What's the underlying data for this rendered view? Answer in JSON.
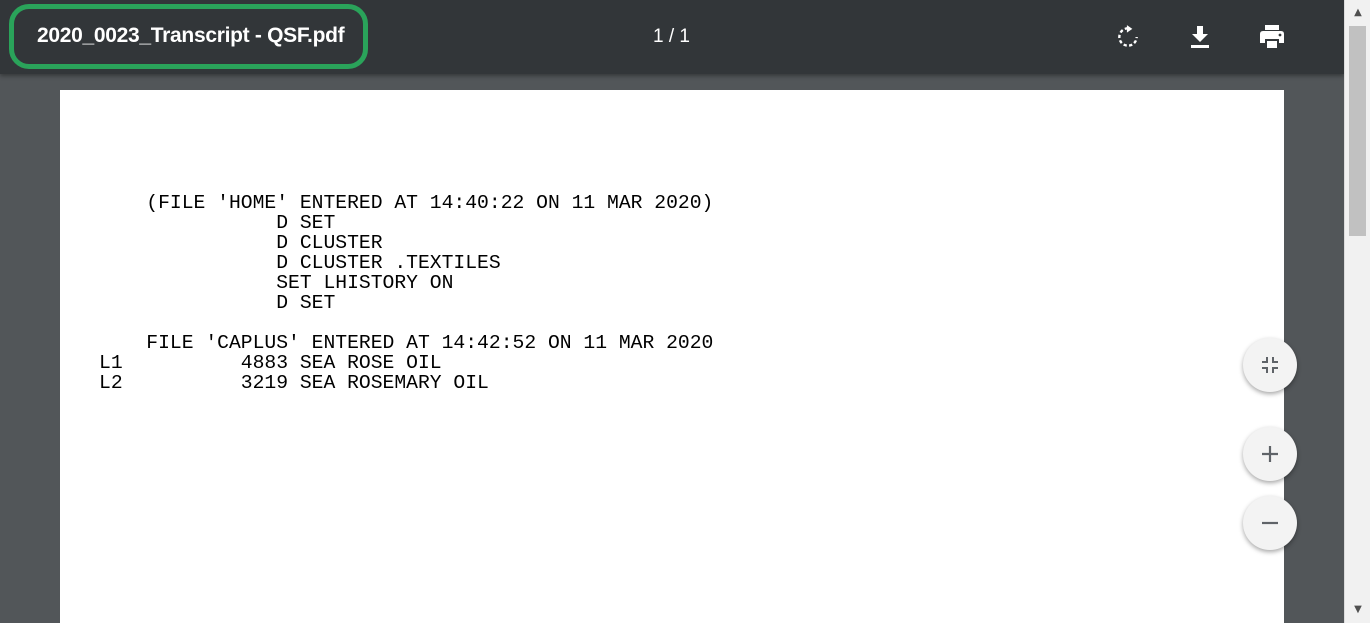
{
  "toolbar": {
    "title": "2020_0023_Transcript - QSF.pdf",
    "page_indicator": "1 / 1",
    "title_highlight_color": "#2aa35a",
    "rotate_icon": "rotate-icon",
    "download_icon": "download-icon",
    "print_icon": "print-icon"
  },
  "document": {
    "lines": [
      "    (FILE 'HOME' ENTERED AT 14:40:22 ON 11 MAR 2020)",
      "               D SET",
      "               D CLUSTER",
      "               D CLUSTER .TEXTILES",
      "               SET LHISTORY ON",
      "               D SET",
      "",
      "    FILE 'CAPLUS' ENTERED AT 14:42:52 ON 11 MAR 2020",
      "L1          4883 SEA ROSE OIL",
      "L2          3219 SEA ROSEMARY OIL"
    ]
  },
  "zoom_controls": {
    "fit_icon": "fit-to-page-icon",
    "zoom_in_icon": "plus-icon",
    "zoom_out_icon": "minus-icon"
  },
  "scrollbar": {
    "up_arrow": "▲",
    "down_arrow": "▼"
  }
}
